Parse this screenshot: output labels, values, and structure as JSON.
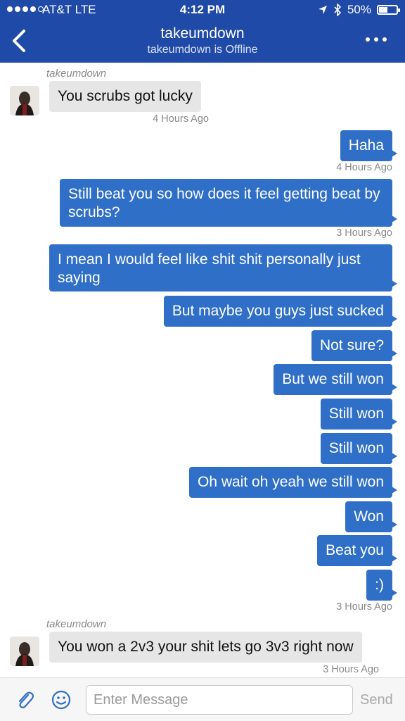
{
  "status_bar": {
    "carrier": "AT&T  LTE",
    "time": "4:12 PM",
    "battery": "50%",
    "battery_level": 0.5
  },
  "header": {
    "title": "takeumdown",
    "subtitle": "takeumdown is Offline"
  },
  "messages": [
    {
      "sender": "takeumdown",
      "text": "You scrubs got lucky",
      "time": "4 Hours Ago"
    },
    {
      "text": "Haha",
      "time": "4 Hours Ago"
    },
    {
      "text": "Still beat you so how does it feel getting beat by scrubs?",
      "time": "3 Hours Ago"
    },
    {
      "text": "I mean I would feel like shit shit personally just saying"
    },
    {
      "text": "But maybe you guys just sucked"
    },
    {
      "text": "Not  sure?"
    },
    {
      "text": "But we still won"
    },
    {
      "text": "Still won"
    },
    {
      "text": "Still won"
    },
    {
      "text": "Oh wait  oh yeah we still won"
    },
    {
      "text": "Won"
    },
    {
      "text": "Beat you"
    },
    {
      "text": ":)",
      "time": "3 Hours Ago"
    },
    {
      "sender": "takeumdown",
      "text": "You won a 2v3 your shit lets go 3v3 right now",
      "time": "3 Hours Ago"
    }
  ],
  "composer": {
    "placeholder": "Enter Message",
    "send_label": "Send"
  },
  "colors": {
    "header": "#1f4aa8",
    "outgoing_bubble": "#2f6fc7",
    "incoming_bubble": "#e6e6e6"
  }
}
